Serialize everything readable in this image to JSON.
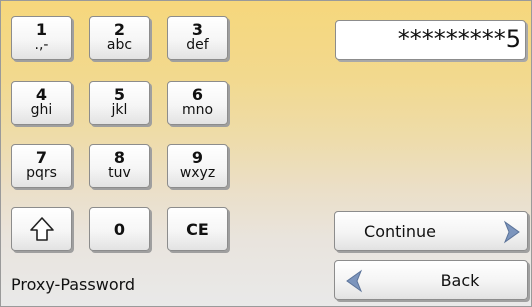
{
  "keypad": {
    "keys": [
      {
        "digit": "1",
        "letters": ".,-"
      },
      {
        "digit": "2",
        "letters": "abc"
      },
      {
        "digit": "3",
        "letters": "def"
      },
      {
        "digit": "4",
        "letters": "ghi"
      },
      {
        "digit": "5",
        "letters": "jkl"
      },
      {
        "digit": "6",
        "letters": "mno"
      },
      {
        "digit": "7",
        "letters": "pqrs"
      },
      {
        "digit": "8",
        "letters": "tuv"
      },
      {
        "digit": "9",
        "letters": "wxyz"
      }
    ],
    "shift_icon": "shift-up-arrow-icon",
    "zero_label": "0",
    "clear_label": "CE"
  },
  "password_field": {
    "value": "*********5"
  },
  "field_label": "Proxy-Password",
  "continue_button": {
    "label": "Continue",
    "icon": "chevron-right-icon"
  },
  "back_button": {
    "label": "Back",
    "icon": "chevron-left-icon"
  },
  "colors": {
    "background_top": "#f6d77c",
    "background_bottom": "#e9e9e9",
    "chevron_blue": "#7c95bd"
  }
}
